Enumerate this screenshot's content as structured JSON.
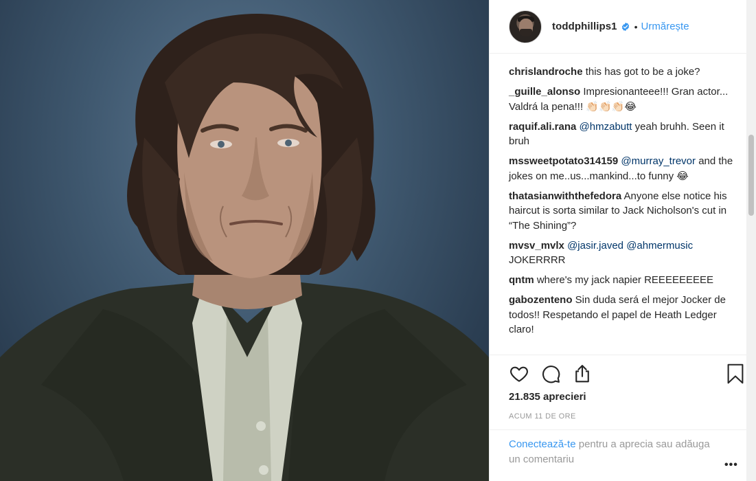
{
  "post": {
    "username": "toddphillips1",
    "separator": "•",
    "follow_label": "Urmărește",
    "verified_icon": "verified-badge-icon"
  },
  "comments": [
    {
      "user": "chrislandroche",
      "parts": [
        {
          "type": "text",
          "value": "this has got to be a joke?"
        }
      ]
    },
    {
      "user": "_guille_alonso",
      "parts": [
        {
          "type": "text",
          "value": "Impresionanteee!!! Gran actor... Valdrá la pena!!! 👏🏻👏🏻👏🏻😂"
        }
      ]
    },
    {
      "user": "raquif.ali.rana",
      "parts": [
        {
          "type": "mention",
          "value": "@hmzabutt"
        },
        {
          "type": "text",
          "value": "yeah bruhh. Seen it bruh"
        }
      ]
    },
    {
      "user": "mssweetpotato314159",
      "parts": [
        {
          "type": "mention",
          "value": "@murray_trevor"
        },
        {
          "type": "text",
          "value": "and the jokes on me..us...mankind...to funny 😂"
        }
      ]
    },
    {
      "user": "thatasianwiththefedora",
      "parts": [
        {
          "type": "text",
          "value": "Anyone else notice his haircut is sorta similar to Jack Nicholson's cut in “The Shining”?"
        }
      ]
    },
    {
      "user": "mvsv_mvlx",
      "parts": [
        {
          "type": "mention",
          "value": "@jasir.javed"
        },
        {
          "type": "mention",
          "value": "@ahmermusic"
        },
        {
          "type": "text",
          "value": "JOKERRRR"
        }
      ]
    },
    {
      "user": "qntm",
      "parts": [
        {
          "type": "text",
          "value": "where's my jack napier REEEEEEEEE"
        }
      ]
    },
    {
      "user": "gabozenteno",
      "parts": [
        {
          "type": "text",
          "value": "Sin duda será el mejor Jocker de todos!! Respetando el papel de Heath Ledger claro!"
        }
      ]
    }
  ],
  "actions": {
    "like_icon": "heart-icon",
    "comment_icon": "comment-bubble-icon",
    "share_icon": "share-icon",
    "save_icon": "bookmark-icon",
    "likes_text": "21.835 aprecieri",
    "timestamp": "ACUM 11 DE ORE"
  },
  "login_prompt": {
    "link_text": "Conectează-te",
    "rest_text": "pentru a aprecia sau adăuga un comentariu",
    "more_icon": "more-options-icon",
    "more_label": "•••"
  },
  "colors": {
    "link_blue": "#3897f0",
    "mention_blue": "#003569",
    "muted_gray": "#999999",
    "text": "#262626"
  }
}
